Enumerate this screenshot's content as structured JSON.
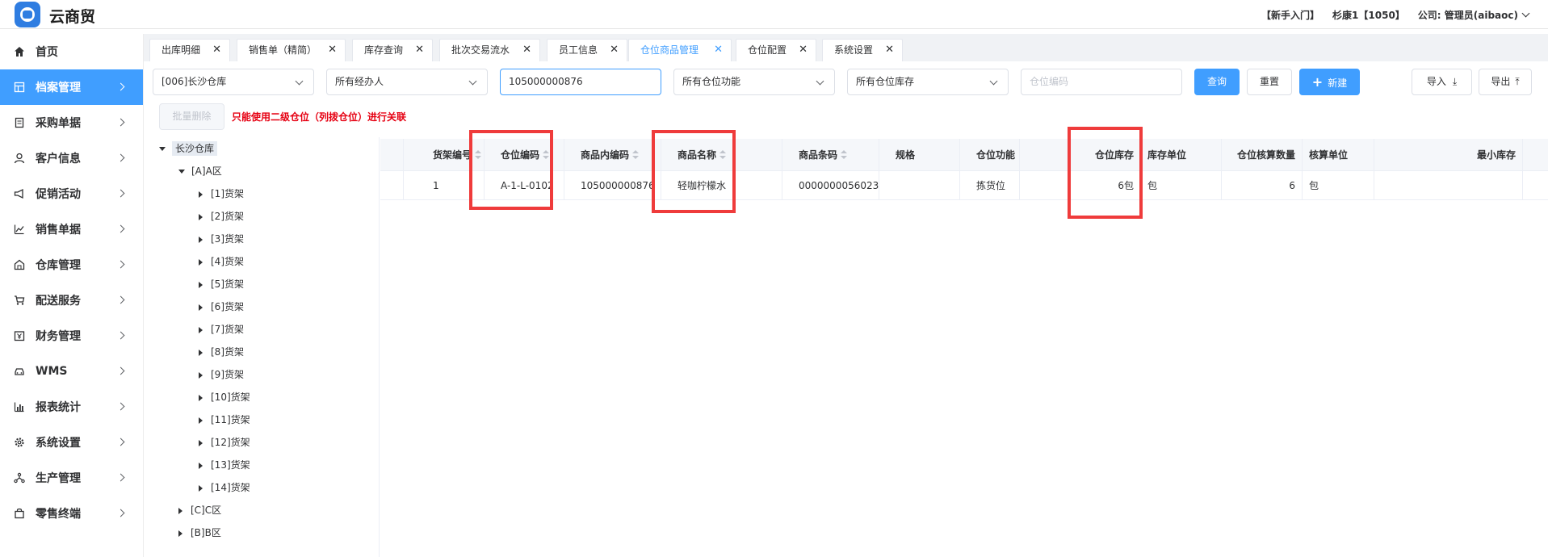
{
  "app": {
    "name": "云商贸"
  },
  "header": {
    "guide": "【新手入门】",
    "user": "杉康1【1050】",
    "company": "公司: 管理员(aibaoc)"
  },
  "sidebar": {
    "items": [
      {
        "label": "首页",
        "icon": "home-icon"
      },
      {
        "label": "档案管理",
        "icon": "archive-icon",
        "active": true
      },
      {
        "label": "采购单据",
        "icon": "purchase-doc-icon"
      },
      {
        "label": "客户信息",
        "icon": "user-icon"
      },
      {
        "label": "促销活动",
        "icon": "megaphone-icon"
      },
      {
        "label": "销售单据",
        "icon": "chart-line-icon"
      },
      {
        "label": "仓库管理",
        "icon": "warehouse-icon"
      },
      {
        "label": "配送服务",
        "icon": "cart-icon"
      },
      {
        "label": "财务管理",
        "icon": "finance-icon"
      },
      {
        "label": "WMS",
        "icon": "car-icon"
      },
      {
        "label": "报表统计",
        "icon": "bar-chart-icon"
      },
      {
        "label": "系统设置",
        "icon": "gear-icon"
      },
      {
        "label": "生产管理",
        "icon": "network-icon"
      },
      {
        "label": "零售终端",
        "icon": "bag-icon"
      }
    ]
  },
  "tabs": [
    {
      "label": "出库明细"
    },
    {
      "label": "销售单（精简）"
    },
    {
      "label": "库存查询"
    },
    {
      "label": "批次交易流水"
    },
    {
      "label": "员工信息"
    },
    {
      "label": "仓位商品管理",
      "active": true
    },
    {
      "label": "仓位配置"
    },
    {
      "label": "系统设置"
    }
  ],
  "filters": {
    "warehouse": "[006]长沙仓库",
    "handler": "所有经办人",
    "search_value": "105000000876",
    "function": "所有仓位功能",
    "stock": "所有仓位库存",
    "location_placeholder": "仓位编码"
  },
  "buttons": {
    "query": "查询",
    "reset": "重置",
    "new": "新建",
    "import": "导入",
    "export": "导出",
    "batch_delete": "批量删除"
  },
  "warning": "只能使用二级仓位（列拨仓位）进行关联",
  "tree": {
    "root": "长沙仓库",
    "zone_a": "[A]A区",
    "shelves": [
      "[1]货架",
      "[2]货架",
      "[3]货架",
      "[4]货架",
      "[5]货架",
      "[6]货架",
      "[7]货架",
      "[8]货架",
      "[9]货架",
      "[10]货架",
      "[11]货架",
      "[12]货架",
      "[13]货架",
      "[14]货架"
    ],
    "zone_c": "[C]C区",
    "zone_b": "[B]B区"
  },
  "table": {
    "headers": [
      "货架编号",
      "仓位编码",
      "商品内编码",
      "商品名称",
      "商品条码",
      "规格",
      "仓位功能",
      "仓位库存",
      "库存单位",
      "仓位核算数量",
      "核算单位",
      "最小库存"
    ],
    "rows": [
      [
        "1",
        "A-1-L-0102",
        "105000000876",
        "轻咖柠檬水",
        "0000000056023",
        "",
        "拣货位",
        "6包",
        "包",
        "6",
        "包",
        ""
      ]
    ]
  },
  "colors": {
    "accent": "#409eff",
    "highlight": "#ef3b3b",
    "warning": "#e60012"
  }
}
